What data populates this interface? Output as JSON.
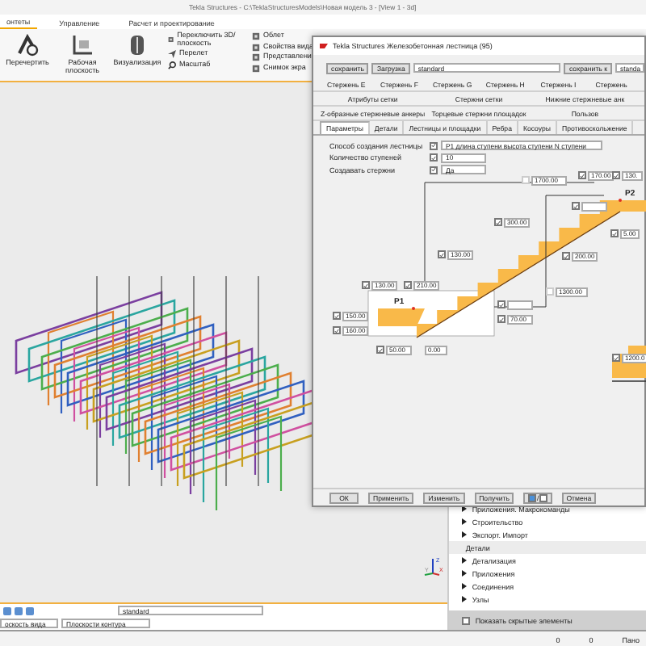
{
  "window": {
    "title": "Tekla Structures - C:\\TeklaStructuresModels\\Новая модель 3 - [View 1 - 3d]"
  },
  "ribbon_tabs": [
    {
      "label": "онтеты",
      "selected": true
    },
    {
      "label": "Управление",
      "selected": false
    },
    {
      "label": "Расчет и проектирование",
      "selected": false
    }
  ],
  "ribbon": {
    "large_buttons": [
      {
        "label": "Перечертить",
        "kind": "redraw"
      },
      {
        "label": "Рабочая плоскость",
        "kind": "plane"
      },
      {
        "label": "Визуализация",
        "kind": "render"
      }
    ],
    "small_columns": [
      [
        {
          "label": "Переключить 3D/ плоскость",
          "kind": "toggle"
        },
        {
          "label": "Перелет",
          "kind": "fly"
        },
        {
          "label": "Масштаб",
          "kind": "zoom"
        }
      ],
      [
        {
          "label": "Облет",
          "kind": "orbit"
        },
        {
          "label": "Свойства вида",
          "kind": "props"
        },
        {
          "label": "Представлени",
          "kind": "repr"
        },
        {
          "label": "Снимок экра",
          "kind": "shot"
        }
      ]
    ]
  },
  "view": {
    "axis_labels": [
      "Z",
      "Y",
      "X"
    ]
  },
  "dialog": {
    "title": "Tekla Structures  Железобетонная лестница (95)",
    "toolbar": {
      "save": "сохранить",
      "load": "Загрузка",
      "preset": "standard",
      "save_as": "сохранить к",
      "save_as_name": "standa"
    },
    "tab_rows": [
      [
        {
          "label": "Стержень E",
          "selected": false
        },
        {
          "label": "Стержень F",
          "selected": false
        },
        {
          "label": "Стержень G",
          "selected": false
        },
        {
          "label": "Стержень H",
          "selected": false
        },
        {
          "label": "Стержень I",
          "selected": false
        },
        {
          "label": "Стержень",
          "selected": false
        }
      ],
      [
        {
          "label": "Атрибуты сетки",
          "selected": false
        },
        {
          "label": "Стержни сетки",
          "selected": false
        },
        {
          "label": "Нижние стержневые анк",
          "selected": false
        }
      ],
      [
        {
          "label": "Z-образные стержневые анкеры",
          "selected": false
        },
        {
          "label": "Торцевые стержни площадок",
          "selected": false
        },
        {
          "label": "Пользов",
          "selected": false
        }
      ],
      [
        {
          "label": "Параметры",
          "selected": true
        },
        {
          "label": "Детали",
          "selected": false
        },
        {
          "label": "Лестницы и площадки",
          "selected": false
        },
        {
          "label": "Ребра",
          "selected": false
        },
        {
          "label": "Косоуры",
          "selected": false
        },
        {
          "label": "Противоскольжение",
          "selected": false
        }
      ]
    ],
    "params": [
      {
        "label": "Способ создания лестницы",
        "checked": true,
        "kind": "select",
        "value": "P1 длина ступени высота ступени N ступени"
      },
      {
        "label": "Количество ступеней",
        "checked": true,
        "kind": "input",
        "value": "10"
      },
      {
        "label": "Создавать стержни",
        "checked": true,
        "kind": "select",
        "value": "Да"
      }
    ],
    "diagram": {
      "points": [
        "P1",
        "P2"
      ],
      "fields": [
        {
          "kind": "field",
          "value": "1700.00",
          "checked": false
        },
        {
          "kind": "field",
          "value": "170.00",
          "checked": true
        },
        {
          "kind": "field",
          "value": "130.",
          "checked": true
        },
        {
          "kind": "field",
          "checked": true
        },
        {
          "kind": "field",
          "value": "300.00",
          "checked": true
        },
        {
          "kind": "field",
          "value": "130.00",
          "checked": true
        },
        {
          "kind": "field",
          "value": "200.00",
          "checked": true
        },
        {
          "kind": "field",
          "value": "5.00",
          "checked": true
        },
        {
          "kind": "field",
          "value": "1300.00",
          "checked": false
        },
        {
          "kind": "field",
          "value": "130.00",
          "checked": true
        },
        {
          "kind": "field",
          "value": "210.00",
          "checked": true
        },
        {
          "kind": "field",
          "value": "150.00",
          "checked": true
        },
        {
          "kind": "field",
          "value": "160.00",
          "checked": true
        },
        {
          "kind": "field",
          "checked": true
        },
        {
          "kind": "field",
          "value": "70.00",
          "checked": true
        },
        {
          "kind": "field",
          "value": "50.00",
          "checked": true
        },
        {
          "kind": "plain",
          "value": "0.00"
        },
        {
          "kind": "field",
          "value": "1200.0",
          "checked": true
        }
      ]
    },
    "buttons": [
      {
        "label": "ОК",
        "kind": "button"
      },
      {
        "label": "Применить",
        "kind": "button"
      },
      {
        "label": "Изменить",
        "kind": "button"
      },
      {
        "label": "Получить",
        "kind": "button"
      },
      {
        "label": "/",
        "kind": "toggle"
      },
      {
        "label": "Отмена",
        "kind": "button"
      }
    ]
  },
  "side_panel": {
    "items": [
      {
        "label": "Приложения. Макрокоманды",
        "kind": "group"
      },
      {
        "label": "Строительство",
        "kind": "group"
      },
      {
        "label": "Экспорт. Импорт",
        "kind": "group"
      },
      {
        "label": "Детали",
        "kind": "header"
      },
      {
        "label": "Детализация",
        "kind": "group"
      },
      {
        "label": "Приложения",
        "kind": "group"
      },
      {
        "label": "Соединения",
        "kind": "group"
      },
      {
        "label": "Узлы",
        "kind": "group"
      }
    ],
    "show_hidden": {
      "label": "Показать скрытые элементы",
      "checked": false
    }
  },
  "view_toolbar": {
    "preset": "standard",
    "view_plane": "оскость вида",
    "contour_plane": "Плоскости контура"
  },
  "status_bar": [
    "0",
    "0",
    "Пано"
  ]
}
